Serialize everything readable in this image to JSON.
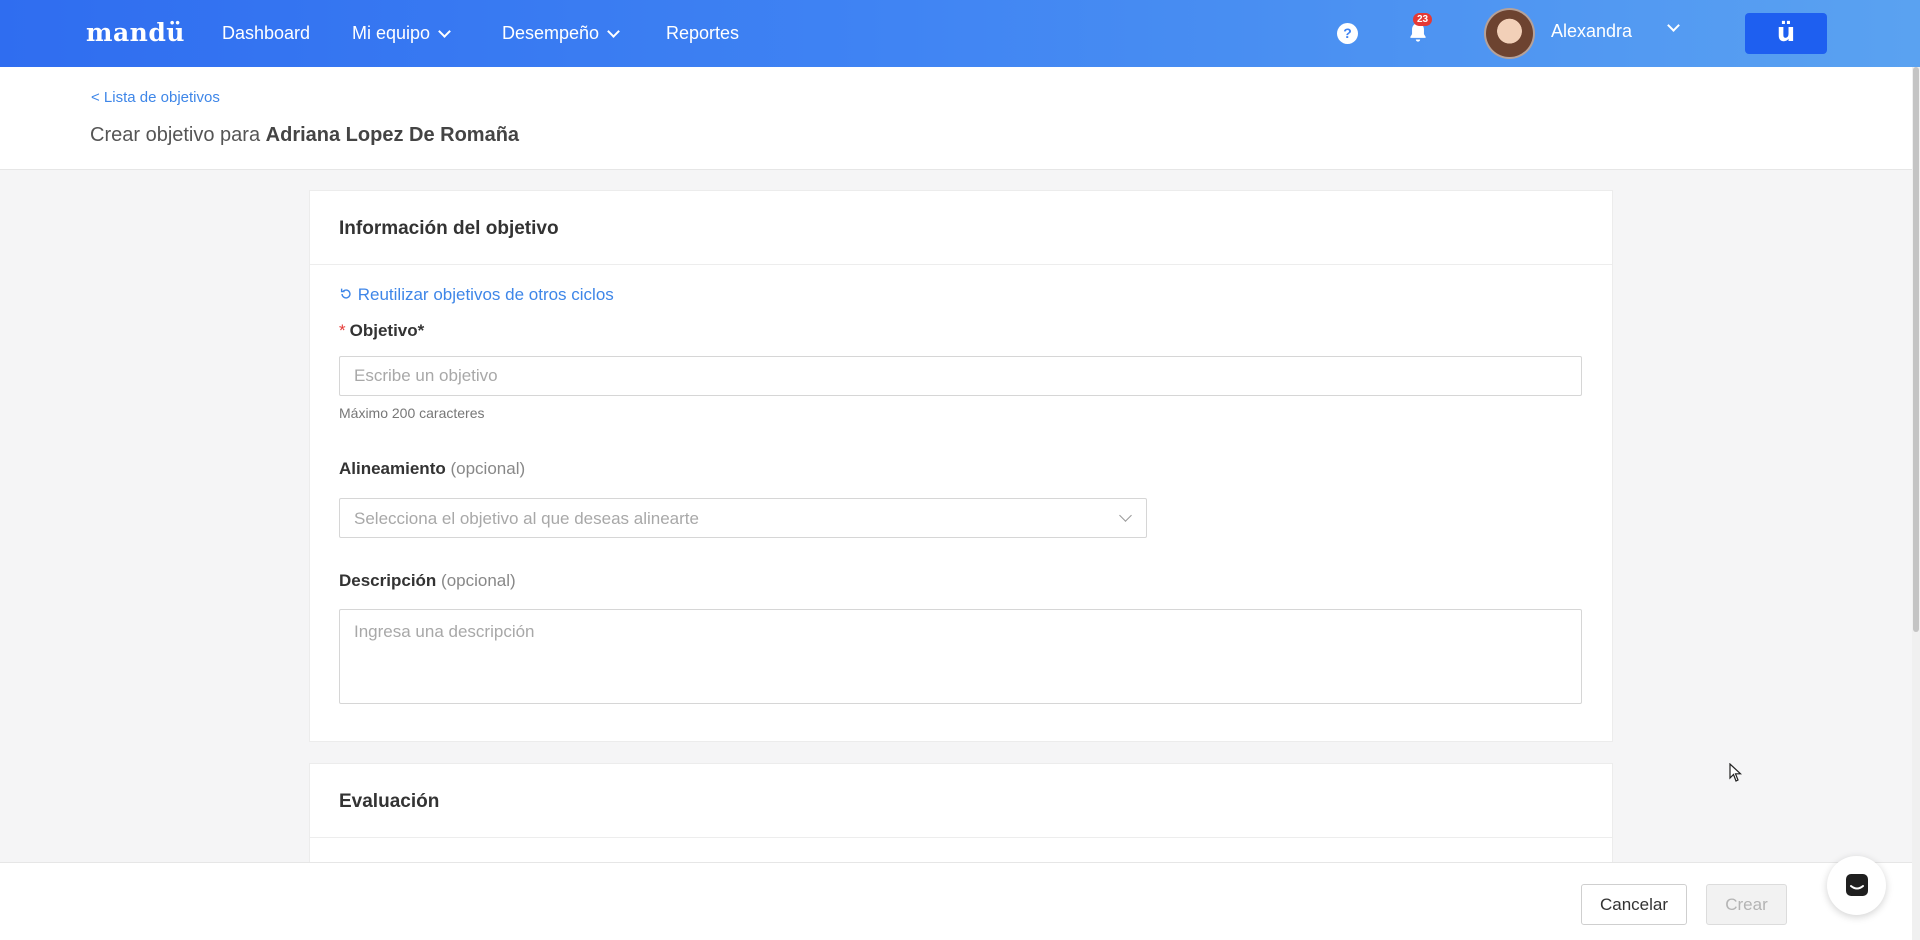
{
  "nav": {
    "logo": "mandü",
    "items": [
      {
        "label": "Dashboard"
      },
      {
        "label": "Mi equipo"
      },
      {
        "label": "Desempeño"
      },
      {
        "label": "Reportes"
      }
    ],
    "help_icon": "?",
    "notifications_count": "23",
    "user_name": "Alexandra",
    "brand_button": "ü"
  },
  "header": {
    "breadcrumb": "< Lista de objetivos",
    "title_prefix": "Crear objetivo para",
    "title_name": "Adriana Lopez De Romaña"
  },
  "info_card": {
    "title": "Información del objetivo",
    "reuse_link": "Reutilizar objetivos de otros ciclos",
    "objective_required_mark": "*",
    "objective_label": "Objetivo*",
    "objective_placeholder": "Escribe un objetivo",
    "objective_value": "",
    "objective_hint": "Máximo 200 caracteres",
    "alignment_label": "Alineamiento",
    "alignment_optional": "(opcional)",
    "alignment_placeholder": "Selecciona el objetivo al que deseas alinearte",
    "description_label": "Descripción",
    "description_optional": "(opcional)",
    "description_placeholder": "Ingresa una descripción"
  },
  "evaluation_card": {
    "title": "Evaluación"
  },
  "footer": {
    "cancel_label": "Cancelar",
    "create_label": "Crear"
  },
  "colors": {
    "nav_gradient_start": "#2f6df0",
    "nav_gradient_end": "#5aa2f1",
    "link": "#3e86e8",
    "required": "#e53935"
  },
  "icons": [
    "chevron-down-icon",
    "help-icon",
    "bell-icon",
    "avatar",
    "refresh-icon",
    "chat-icon",
    "cursor-icon"
  ]
}
